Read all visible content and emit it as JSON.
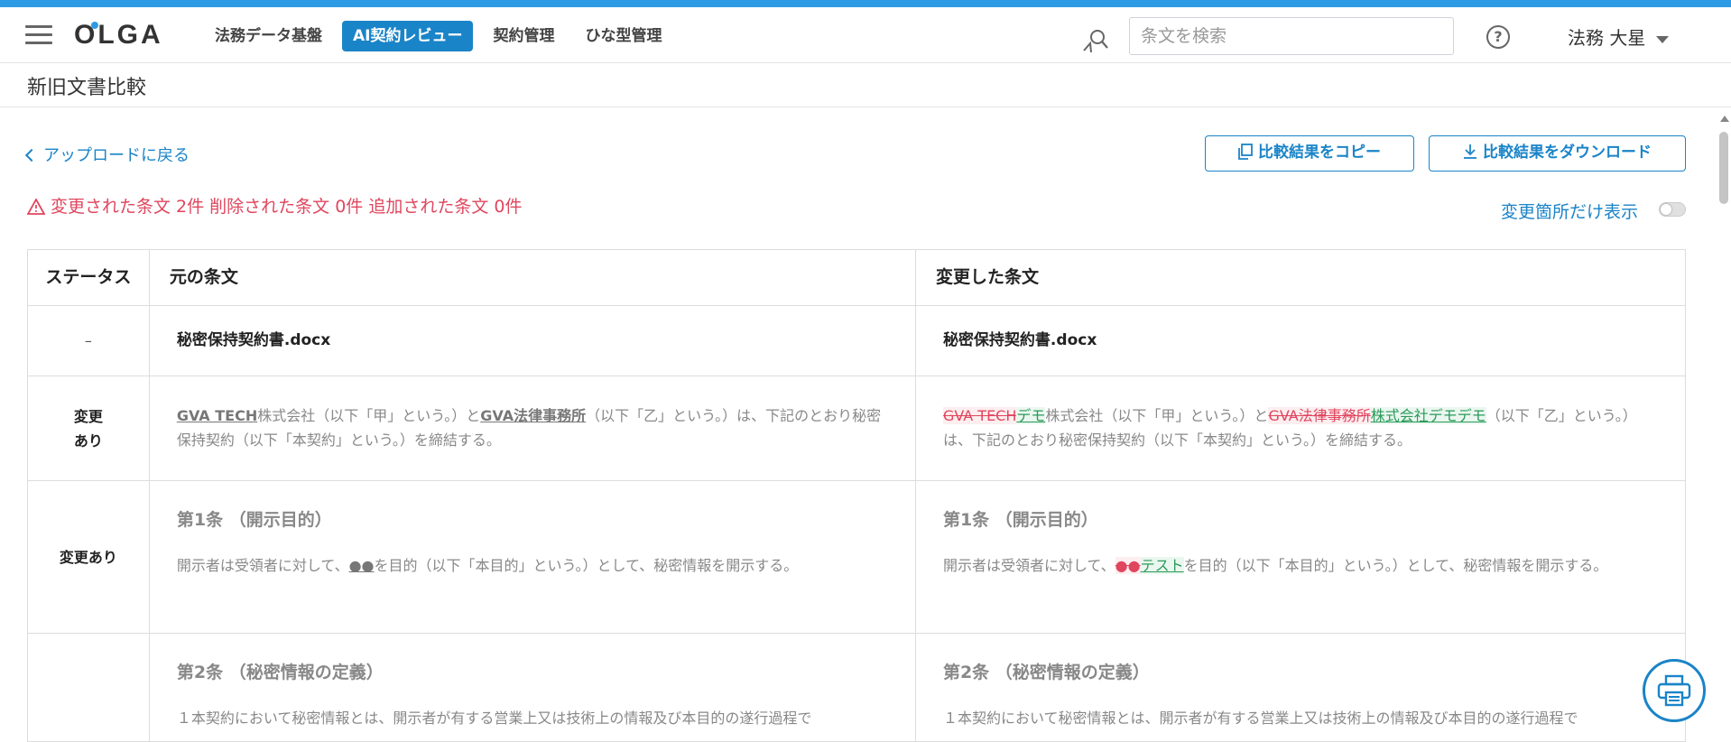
{
  "header": {
    "logo": "OLGA",
    "nav": [
      "法務データ基盤",
      "AI契約レビュー",
      "契約管理",
      "ひな型管理"
    ],
    "search_placeholder": "条文を検索",
    "user_name": "法務 大星"
  },
  "page": {
    "title": "新旧文書比較",
    "back_label": "アップロードに戻る",
    "copy_button": "比較結果をコピー",
    "download_button": "比較結果をダウンロード",
    "warning": "変更された条文 2件 削除された条文 0件 追加された条文 0件",
    "toggle_label": "変更箇所だけ表示"
  },
  "table": {
    "headers": [
      "ステータス",
      "元の条文",
      "変更した条文"
    ],
    "file_row": {
      "status": "–",
      "orig": "秘密保持契約書.docx",
      "new": "秘密保持契約書.docx"
    },
    "row1": {
      "status": "変更あり",
      "orig": {
        "p1": "GVA TECH",
        "p2": "株式会社（以下「甲」という。）と",
        "p3": "GVA法律事務所",
        "p4": "（以下「乙」という。）は、下記のとおり秘密保持契約（以下「本契約」という。）を締結する。"
      },
      "new": {
        "del1": "GVA TECH",
        "ins1": "デモ",
        "t1": "株式会社（以下「甲」という。）と",
        "del2": "GVA法律事務所",
        "ins2": "株式会社デモデモ",
        "t2": "（以下「乙」という。）は、下記のとおり秘密保持契約（以下「本契約」という。）を締結する。"
      }
    },
    "row2": {
      "status": "変更あり",
      "orig": {
        "title": "第1条 （開示目的）",
        "t1": "開示者は受領者に対して、",
        "mark": "●●",
        "t2": "を目的（以下「本目的」という。）として、秘密情報を開示する。"
      },
      "new": {
        "title": "第1条 （開示目的）",
        "t1": "開示者は受領者に対して、",
        "del": "●●",
        "ins": "テスト",
        "t2": "を目的（以下「本目的」という。）として、秘密情報を開示する。"
      }
    },
    "row3": {
      "status": "",
      "orig": {
        "title": "第2条 （秘密情報の定義）",
        "body": "１本契約において秘密情報とは、開示者が有する営業上又は技術上の情報及び本目的の遂行過程で"
      },
      "new": {
        "title": "第2条 （秘密情報の定義）",
        "body": "１本契約において秘密情報とは、開示者が有する営業上又は技術上の情報及び本目的の遂行過程で"
      }
    }
  },
  "colors": {
    "accent": "#1a84c8",
    "deleted": "#e0465e",
    "inserted": "#2a9a5a"
  }
}
